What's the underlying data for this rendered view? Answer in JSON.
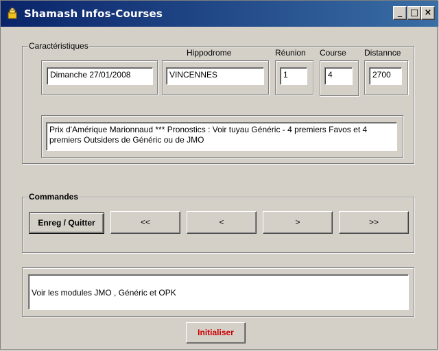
{
  "window": {
    "title": "Shamash Infos-Courses",
    "title_icon": "app-icon",
    "controls": {
      "minimize": "_",
      "maximize": "□",
      "close": "×"
    }
  },
  "caracteristiques": {
    "group_label": "Caractéristiques",
    "labels": {
      "hippodrome": "Hippodrome",
      "reunion": "Réunion",
      "course": "Course",
      "distance": "Distannce"
    },
    "values": {
      "date": "Dimanche  27/01/2008",
      "hippodrome": "VINCENNES",
      "reunion": "1",
      "course": "4",
      "distance": "2700"
    },
    "description": "Prix  d'Amérique Marionnaud  ***   Pronostics : Voir tuyau   Généric  -  4 premiers  Favos  et 4 premiers  Outsiders  de Généric ou de JMO"
  },
  "commandes": {
    "group_label": "Commandes",
    "buttons": {
      "save_quit": "Enreg / Quitter",
      "first": "<<",
      "prev": "<",
      "next": ">",
      "last": ">>"
    }
  },
  "info": {
    "text": "Voir les modules  JMO , Généric  et  OPK"
  },
  "footer": {
    "reset_label": "Initialiser"
  },
  "colors": {
    "titlebar": "#0a246a",
    "face": "#d4d0c8",
    "reset_text": "#cc0000"
  }
}
